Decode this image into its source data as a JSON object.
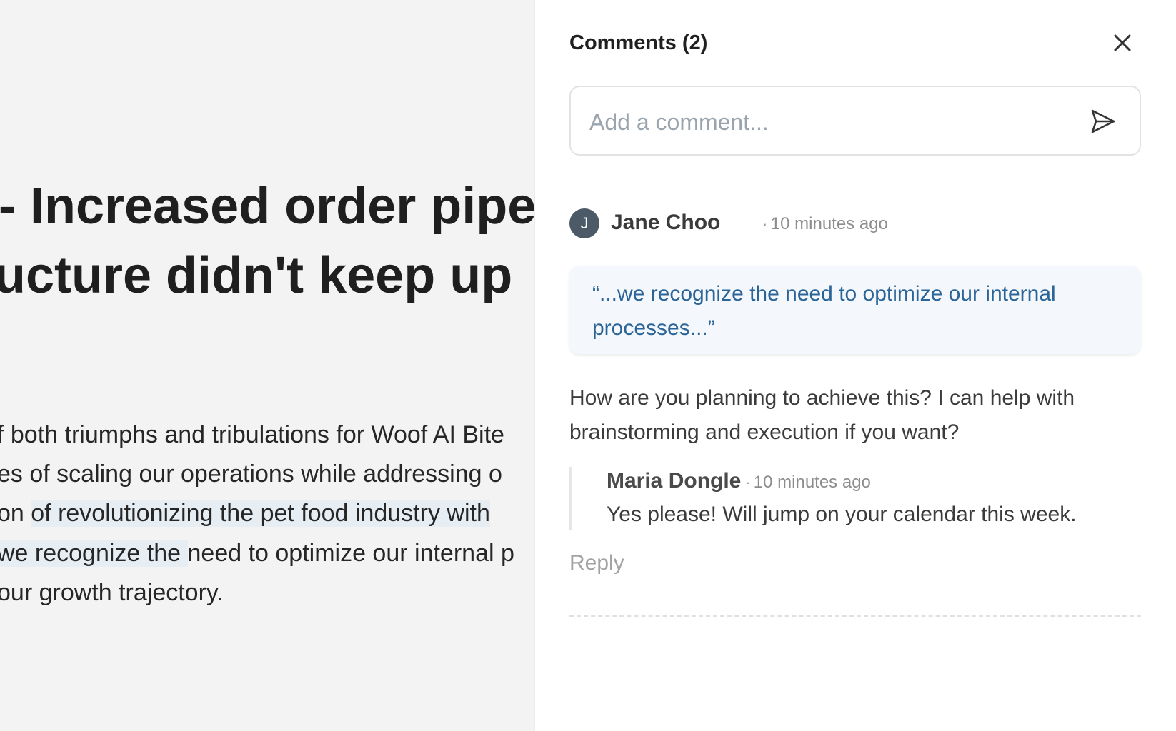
{
  "document": {
    "heading_line_1": "- Increased order pipel",
    "heading_line_2": "ucture didn't keep up",
    "body_line_1": "f both triumphs and tribulations for Woof AI Bite",
    "body_line_2": "es of scaling our operations while addressing o",
    "body_line_3_prefix": "on ",
    "body_line_3_highlight": "of revolutionizing the pet food industry with ",
    "body_line_4_highlight": "we recognize the ",
    "body_line_4_suffix": "need to optimize our internal p",
    "body_line_5": "our growth trajectory."
  },
  "comments_panel": {
    "title": "Comments (2)",
    "close_icon": "close-icon",
    "input_placeholder": "Add a comment...",
    "send_icon": "send-icon",
    "thread": {
      "avatar_initial": "J",
      "author": "Jane Choo",
      "separator": "·",
      "time": "10 minutes ago",
      "quote": "“...we recognize the need to optimize our internal processes...”",
      "body": "How are you planning to achieve this? I can help with brainstorming and execution if you want?",
      "reply": {
        "author": "Maria Dongle",
        "separator": "·",
        "time": "10 minutes ago",
        "text": "Yes please! Will jump on your calendar this week."
      },
      "reply_label": "Reply"
    }
  },
  "colors": {
    "doc_background": "#f3f3f3",
    "highlight": "#e6eef4",
    "quote_text": "#2b6496",
    "avatar_bg": "#4b5a66"
  }
}
